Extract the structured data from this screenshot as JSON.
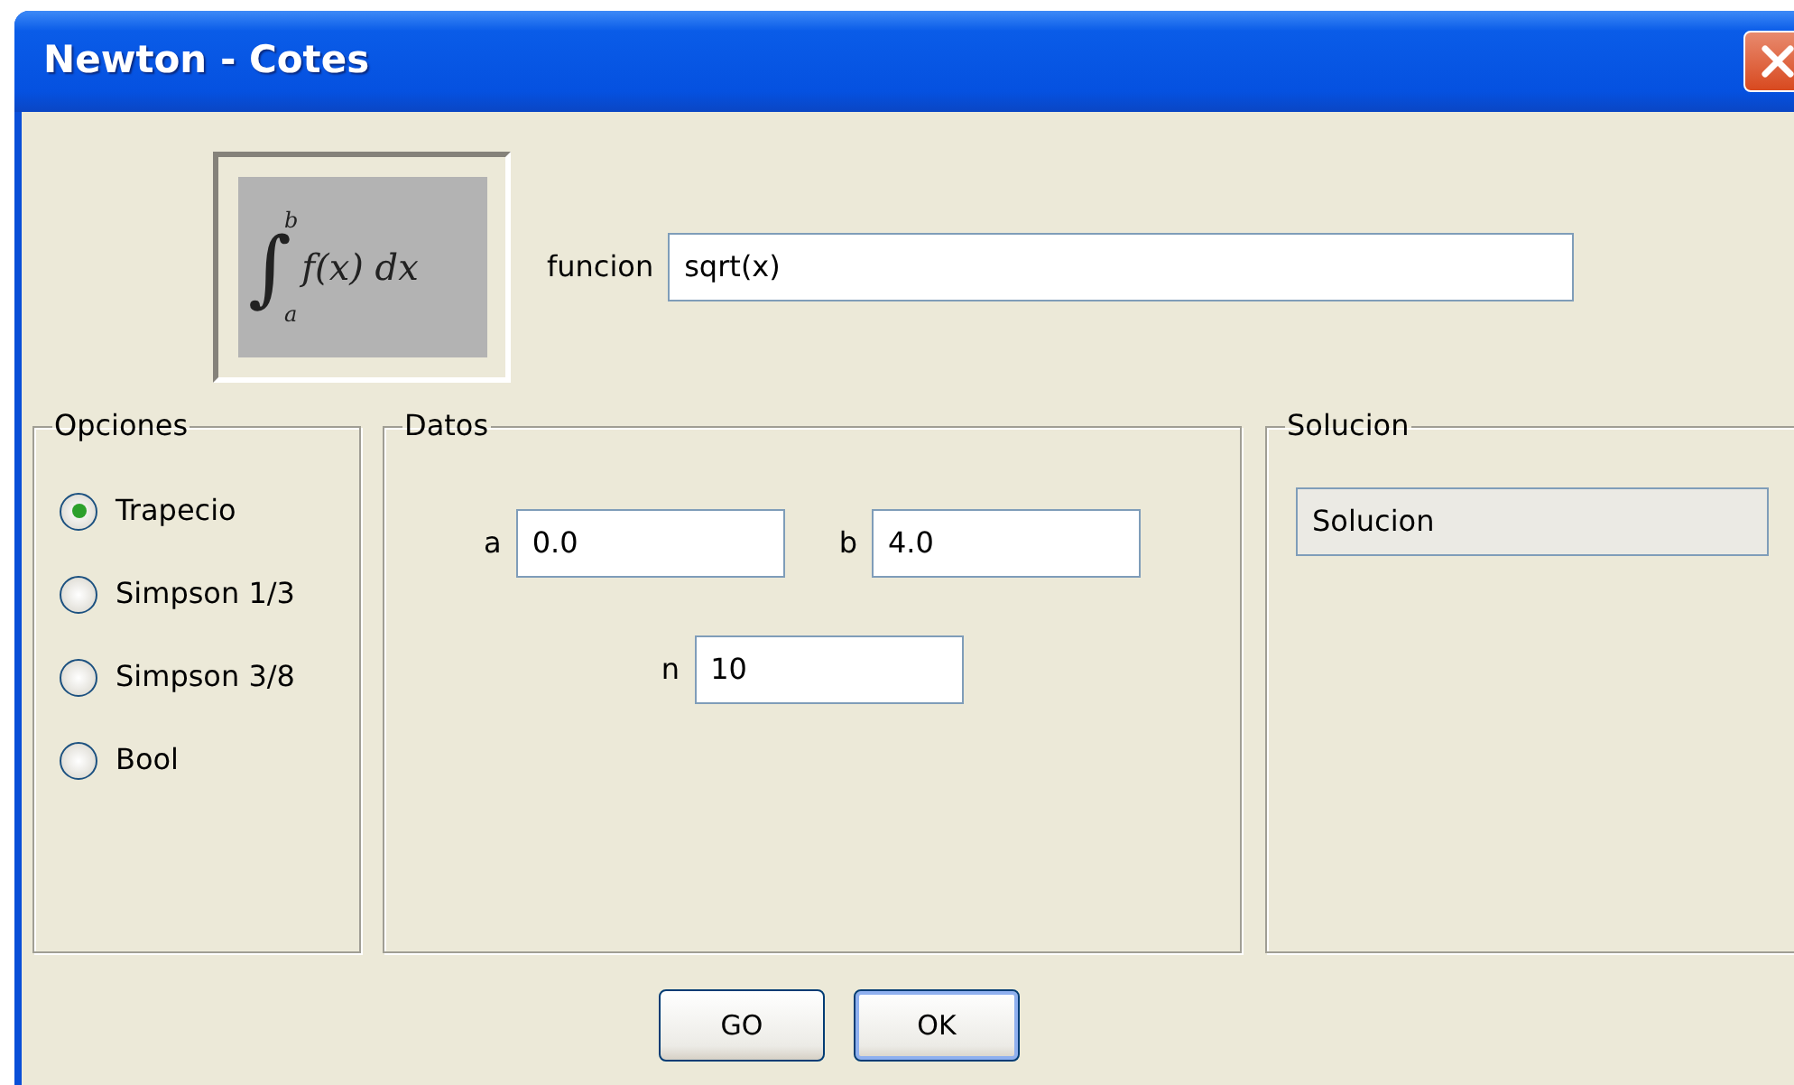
{
  "window": {
    "title": "Newton - Cotes"
  },
  "formula": {
    "sign": "∫",
    "upper": "b",
    "lower": "a",
    "body": "f(x) dx"
  },
  "function_field": {
    "label": "funcion",
    "value": "sqrt(x)"
  },
  "options": {
    "title": "Opciones",
    "items": [
      {
        "label": "Trapecio",
        "selected": true
      },
      {
        "label": "Simpson 1/3",
        "selected": false
      },
      {
        "label": "Simpson 3/8",
        "selected": false
      },
      {
        "label": "Bool",
        "selected": false
      }
    ]
  },
  "data": {
    "title": "Datos",
    "fields": [
      {
        "label": "a",
        "value": "0.0"
      },
      {
        "label": "b",
        "value": "4.0"
      },
      {
        "label": "n",
        "value": "10"
      }
    ]
  },
  "solution": {
    "title": "Solucion",
    "value": "Solucion",
    "disabled": true
  },
  "buttons": [
    {
      "label": "GO",
      "default": false
    },
    {
      "label": "OK",
      "default": true
    }
  ]
}
